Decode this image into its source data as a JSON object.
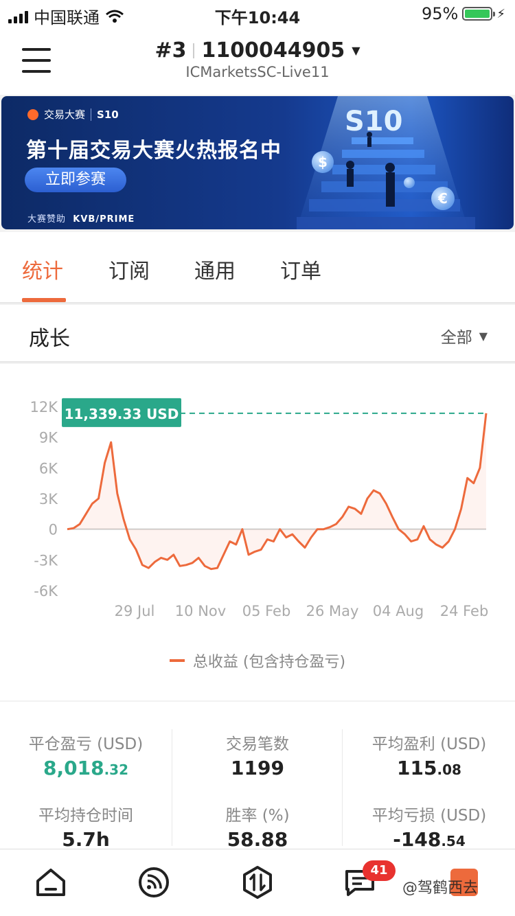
{
  "status_bar": {
    "carrier": "中国联通",
    "time": "下午10:44",
    "battery": "95%"
  },
  "header": {
    "rank": "#3",
    "account_id": "1100044905",
    "server": "ICMarketsSC-Live11"
  },
  "banner": {
    "brand": "交易大赛",
    "brand_badge": "S10",
    "title": "第十届交易大赛火热报名中",
    "cta": "立即参赛",
    "sponsor_label": "大赛赞助",
    "sponsor_name": "KVB/PRIME",
    "badge_big": "S10"
  },
  "tabs": [
    {
      "label": "统计",
      "active": true
    },
    {
      "label": "订阅",
      "active": false
    },
    {
      "label": "通用",
      "active": false
    },
    {
      "label": "订单",
      "active": false
    }
  ],
  "section": {
    "title": "成长",
    "filter": "全部"
  },
  "chart_data": {
    "type": "line",
    "current_value_label": "11,339.33 USD",
    "y_ticks": [
      "12K",
      "9K",
      "6K",
      "3K",
      "0",
      "-3K",
      "-6K"
    ],
    "x_ticks": [
      "29 Jul",
      "10 Nov",
      "05 Feb",
      "26 May",
      "04 Aug",
      "24 Feb"
    ],
    "ylim": [
      -6000,
      12000
    ],
    "series": [
      {
        "name": "总收益 (包含持仓盈亏)",
        "color": "#ed6a3c",
        "values": [
          0,
          100,
          500,
          1500,
          2500,
          3000,
          6500,
          8500,
          3500,
          1000,
          -1000,
          -2000,
          -3500,
          -3800,
          -3200,
          -2800,
          -3000,
          -2500,
          -3600,
          -3500,
          -3300,
          -2800,
          -3600,
          -3900,
          -3800,
          -2500,
          -1200,
          -1500,
          0,
          -2500,
          -2200,
          -2000,
          -1000,
          -1200,
          0,
          -800,
          -500,
          -1200,
          -1800,
          -800,
          0,
          0,
          200,
          500,
          1200,
          2200,
          2000,
          1500,
          3000,
          3800,
          3500,
          2500,
          1200,
          0,
          -500,
          -1200,
          -1000,
          300,
          -1000,
          -1500,
          -1800,
          -1200,
          0,
          2000,
          5000,
          4500,
          6000,
          11339
        ]
      }
    ]
  },
  "stats": [
    {
      "label": "平仓盈亏 (USD)",
      "int": "8,018",
      "dec": ".32",
      "style": "green"
    },
    {
      "label": "交易笔数",
      "int": "1199",
      "dec": "",
      "style": "normal"
    },
    {
      "label": "平均盈利 (USD)",
      "int": "115",
      "dec": ".08",
      "style": "normal"
    },
    {
      "label": "平均持仓时间",
      "int": "5.7h",
      "dec": "",
      "style": "normal"
    },
    {
      "label": "胜率 (%)",
      "int": "58.88",
      "dec": "",
      "style": "normal"
    },
    {
      "label": "平均亏损 (USD)",
      "int": "-148",
      "dec": ".54",
      "style": "normal"
    }
  ],
  "bottom_nav": {
    "items": [
      "home-icon",
      "feed-icon",
      "trade-icon",
      "messages-icon",
      "profile-icon"
    ],
    "messages_badge": "41",
    "watermark": "@驾鹤西去"
  }
}
